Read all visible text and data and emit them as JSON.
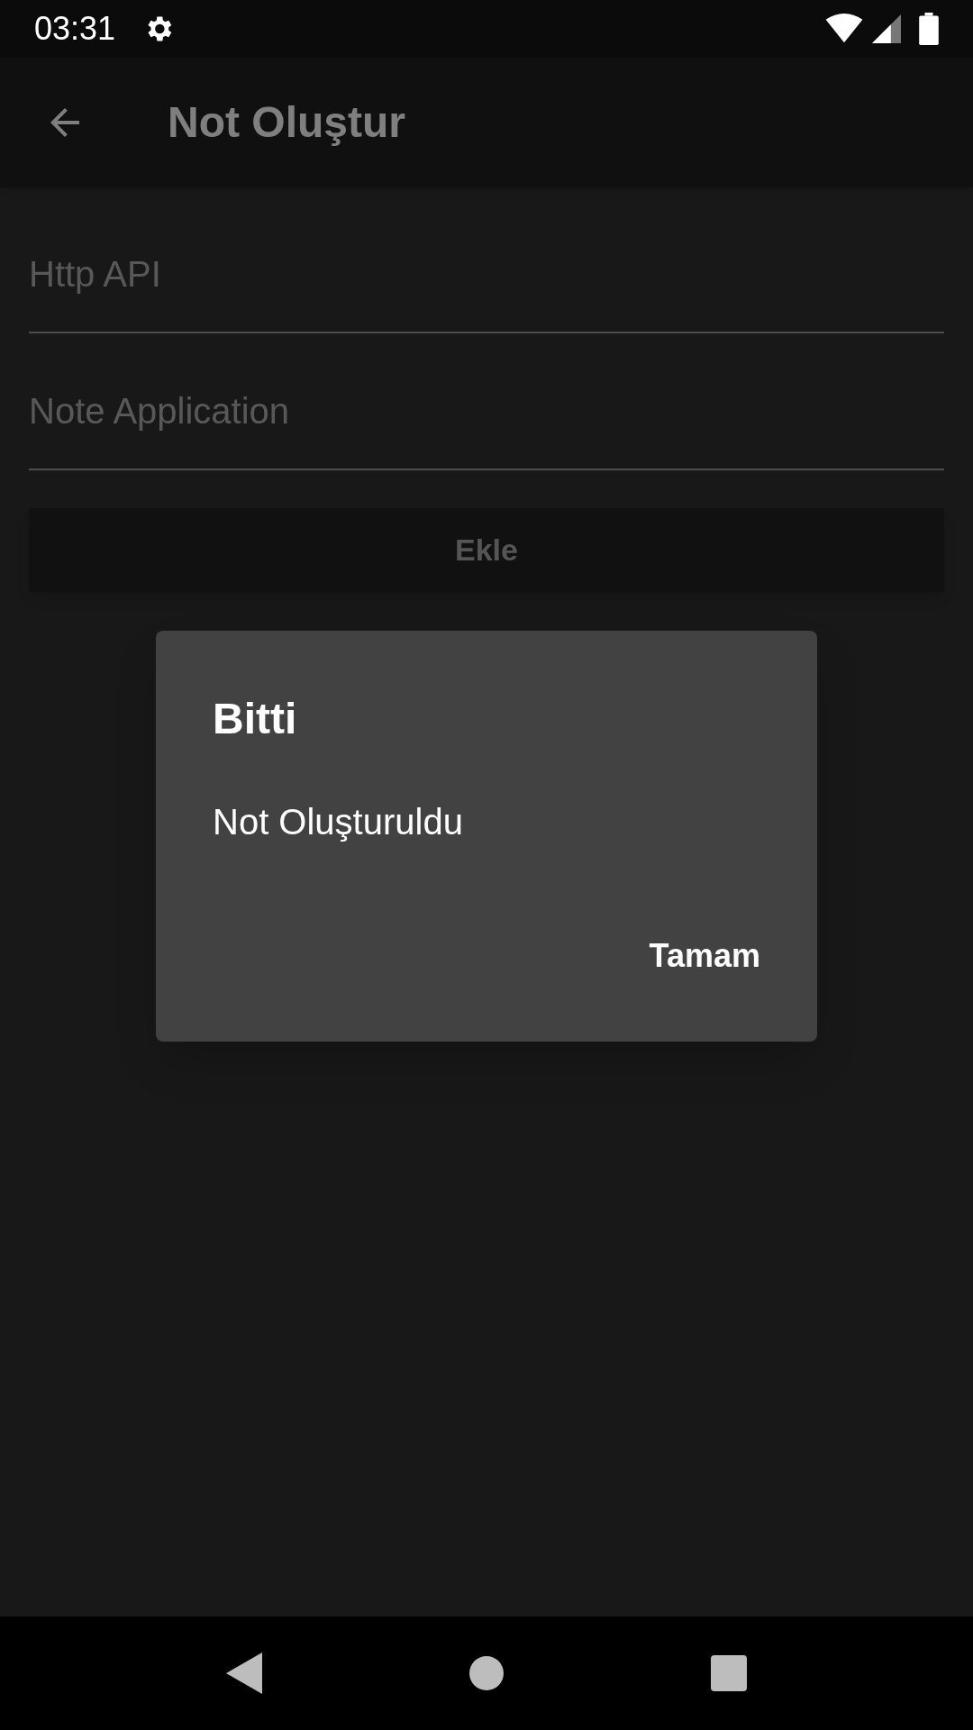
{
  "status_bar": {
    "time": "03:31"
  },
  "app_bar": {
    "title": "Not Oluştur"
  },
  "fields": [
    {
      "placeholder": "Http API"
    },
    {
      "placeholder": "Note Application"
    }
  ],
  "add_button": {
    "label": "Ekle"
  },
  "dialog": {
    "title": "Bitti",
    "message": "Not Oluşturuldu",
    "button": "Tamam"
  }
}
